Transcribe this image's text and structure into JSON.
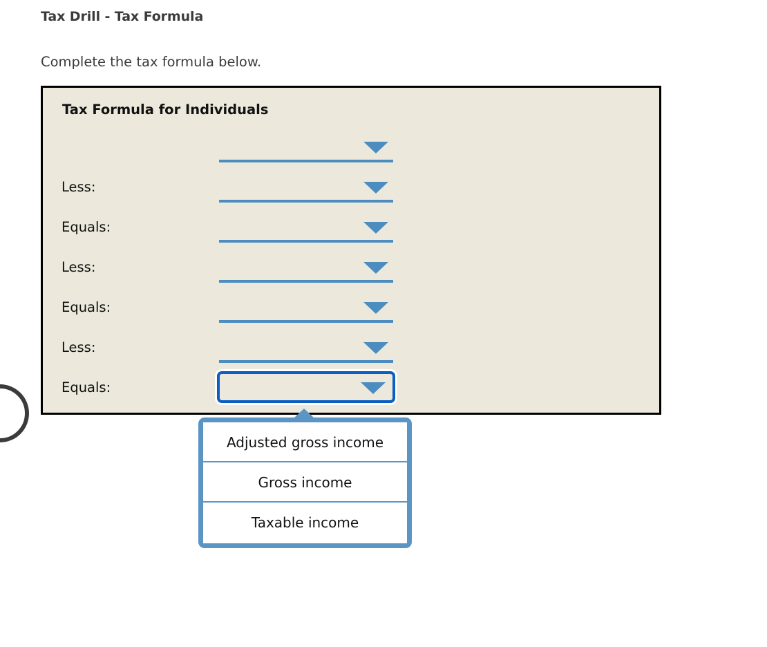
{
  "header": {
    "title": "Tax Drill - Tax Formula",
    "instruction": "Complete the tax formula below."
  },
  "panel": {
    "heading": "Tax Formula for Individuals",
    "background_color": "#ece9dc",
    "border_color": "#000000",
    "rows": [
      {
        "label": "",
        "field_state": "empty",
        "value": ""
      },
      {
        "label": "Less:",
        "field_state": "empty",
        "value": ""
      },
      {
        "label": "Equals:",
        "field_state": "empty",
        "value": ""
      },
      {
        "label": "Less:",
        "field_state": "empty",
        "value": ""
      },
      {
        "label": "Equals:",
        "field_state": "empty",
        "value": ""
      },
      {
        "label": "Less:",
        "field_state": "empty",
        "value": ""
      },
      {
        "label": "Equals:",
        "field_state": "focused",
        "value": ""
      }
    ]
  },
  "dropdown": {
    "open": true,
    "accent_color": "#5b95c4",
    "focus_color": "#0b5ec2",
    "underline_color": "#4c8cbf",
    "options": [
      "Adjusted gross income",
      "Gross income",
      "Taxable income"
    ]
  }
}
